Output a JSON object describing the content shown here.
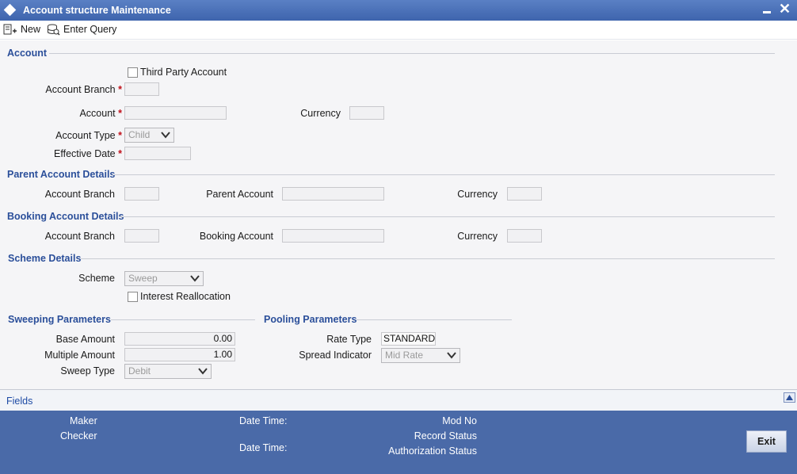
{
  "window": {
    "title": "Account structure Maintenance"
  },
  "toolbar": {
    "new_label": "New",
    "enter_query_label": "Enter Query"
  },
  "account": {
    "section_title": "Account",
    "third_party_label": "Third Party Account",
    "third_party_checked": false,
    "branch_label": "Account Branch",
    "account_label": "Account",
    "currency_label": "Currency",
    "type_label": "Account Type",
    "type_value": "Child",
    "effective_date_label": "Effective Date",
    "required_mark": "*"
  },
  "parent": {
    "section_title": "Parent Account Details",
    "branch_label": "Account Branch",
    "account_label": "Parent Account",
    "currency_label": "Currency"
  },
  "booking": {
    "section_title": "Booking Account Details",
    "branch_label": "Account Branch",
    "account_label": "Booking Account",
    "currency_label": "Currency"
  },
  "scheme": {
    "section_title": "Scheme Details",
    "scheme_label": "Scheme",
    "scheme_value": "Sweep",
    "interest_realloc_label": "Interest Reallocation",
    "interest_realloc_checked": false
  },
  "sweeping": {
    "section_title": "Sweeping Parameters",
    "base_amount_label": "Base Amount",
    "base_amount_value": "0.00",
    "multiple_amount_label": "Multiple Amount",
    "multiple_amount_value": "1.00",
    "sweep_type_label": "Sweep Type",
    "sweep_type_value": "Debit"
  },
  "pooling": {
    "section_title": "Pooling Parameters",
    "rate_type_label": "Rate Type",
    "rate_type_value": "STANDARD",
    "spread_indicator_label": "Spread Indicator",
    "spread_indicator_value": "Mid Rate"
  },
  "fields_bar": {
    "label": "Fields"
  },
  "footer": {
    "maker_label": "Maker",
    "checker_label": "Checker",
    "date_time_label_1": "Date Time:",
    "date_time_label_2": "Date Time:",
    "mod_no_label": "Mod No",
    "record_status_label": "Record Status",
    "authorization_status_label": "Authorization Status",
    "exit_label": "Exit"
  },
  "colors": {
    "title_bar": "#3e64ad",
    "section_title": "#2b4f9a",
    "footer": "#4a6aa8",
    "required": "#c0101a"
  }
}
